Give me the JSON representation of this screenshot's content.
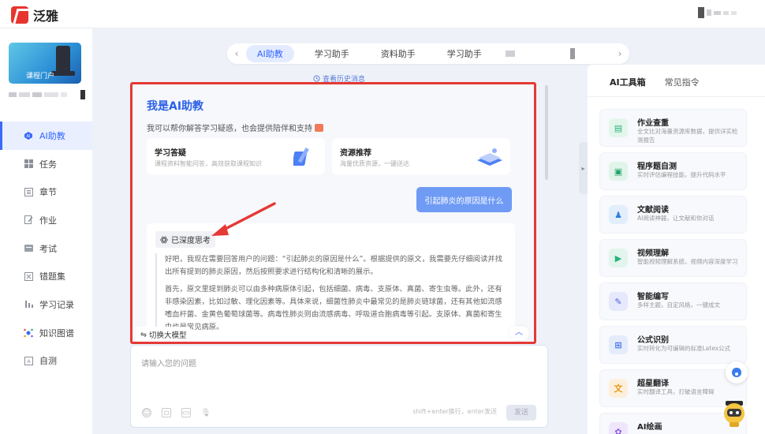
{
  "app": {
    "name": "泛雅"
  },
  "sidebar": {
    "course_card_label": "课程门户",
    "items": [
      {
        "label": "AI助教",
        "icon": "ai-icon",
        "active": true
      },
      {
        "label": "任务",
        "icon": "grid-icon"
      },
      {
        "label": "章节",
        "icon": "list-icon"
      },
      {
        "label": "作业",
        "icon": "edit-icon"
      },
      {
        "label": "考试",
        "icon": "exam-icon"
      },
      {
        "label": "错题集",
        "icon": "close-box-icon"
      },
      {
        "label": "学习记录",
        "icon": "record-icon"
      },
      {
        "label": "知识图谱",
        "icon": "graph-icon"
      },
      {
        "label": "自测",
        "icon": "self-test-icon"
      }
    ]
  },
  "tabs": {
    "items": [
      "AI助教",
      "学习助手",
      "资料助手",
      "学习助手"
    ],
    "active": 0,
    "history_link": "查看历史消息"
  },
  "chat": {
    "title": "我是AI助教",
    "subtitle": "我可以帮你解答学习疑惑，也会提供陪伴和支持",
    "features": [
      {
        "title": "学习答疑",
        "desc": "课程资料智能问答，高效获取课程知识"
      },
      {
        "title": "资源推荐",
        "desc": "海量优质资源，一键送达"
      }
    ],
    "user_message": "引起肺炎的原因是什么",
    "think_label": "已深度思考",
    "answer_paragraphs": [
      "好吧，我现在需要回答用户的问题：“引起肺炎的原因是什么”。根据提供的原文，我需要先仔细阅读并找出所有提到的肺炎原因，然后按照要求进行结构化和清晰的展示。",
      "首先，原文里提到肺炎可以由多种病原体引起，包括细菌、病毒、支原体、真菌、寄生虫等。此外，还有非感染因素，比如过敏、理化因素等。具体来说，细菌性肺炎中最常见的是肺炎链球菌，还有其他如流感嗜血杆菌、金黄色葡萄球菌等。病毒性肺炎则由流感病毒、呼吸道合胞病毒等引起。支原体、真菌和寄生虫也是常见病原。"
    ],
    "switch_model": "切换大模型"
  },
  "input": {
    "placeholder": "请输入您的问题",
    "hint": "shift+enter换行，enter发送",
    "send": "发送"
  },
  "right_panel": {
    "tabs": [
      "AI工具箱",
      "常见指令"
    ],
    "tools": [
      {
        "title": "作业查重",
        "desc": "全文比对海量资源库数据，提供详实检测报告",
        "icon": "doc-check-icon",
        "color": "#2db37a",
        "bg": "#e3f6ec"
      },
      {
        "title": "程序题自测",
        "desc": "实时评估编程技能，提升代码水平",
        "icon": "code-icon",
        "color": "#22a36b",
        "bg": "#e1f4ea"
      },
      {
        "title": "文献阅读",
        "desc": "AI阅读神器，让文献和你对话",
        "icon": "reader-icon",
        "color": "#2e7fe0",
        "bg": "#e2eefc"
      },
      {
        "title": "视频理解",
        "desc": "智能视频理解系统，视频内容深度学习",
        "icon": "video-icon",
        "color": "#27b27b",
        "bg": "#e2f5ec"
      },
      {
        "title": "智能编写",
        "desc": "多样主题，自定风格，一键成文",
        "icon": "write-icon",
        "color": "#4b63e6",
        "bg": "#e6e9fc"
      },
      {
        "title": "公式识别",
        "desc": "实时转化为可编辑的标准Latex公式",
        "icon": "formula-icon",
        "color": "#3e6fe8",
        "bg": "#e4ecfc"
      },
      {
        "title": "超星翻译",
        "desc": "实时翻译工具，打破语言障碍",
        "icon": "translate-icon",
        "color": "#e89a1e",
        "bg": "#fcf0dc"
      },
      {
        "title": "AI绘画",
        "desc": "",
        "icon": "paint-icon",
        "color": "#8a5be6",
        "bg": "#efe6fc"
      }
    ]
  }
}
